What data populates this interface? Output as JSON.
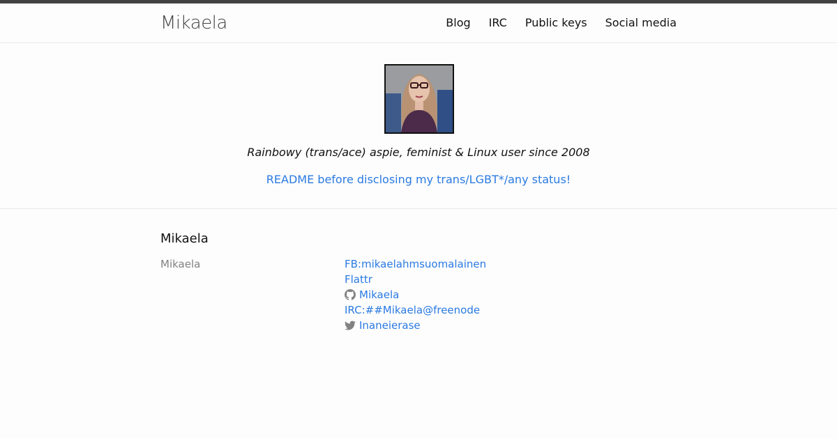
{
  "site": {
    "title": "Mikaela"
  },
  "nav": {
    "items": [
      {
        "label": "Blog"
      },
      {
        "label": "IRC"
      },
      {
        "label": "Public keys"
      },
      {
        "label": "Social media"
      }
    ]
  },
  "hero": {
    "tagline": "Rainbowy (trans/ace) aspie, feminist & Linux user since 2008",
    "readme_link": "README before disclosing my trans/LGBT*/any status!"
  },
  "footer": {
    "heading": "Mikaela",
    "name": "Mikaela",
    "links": [
      {
        "label": "FB:mikaelahmsuomalainen",
        "icon": ""
      },
      {
        "label": "Flattr",
        "icon": ""
      },
      {
        "label": "Mikaela",
        "icon": "github-icon"
      },
      {
        "label": "IRC:##Mikaela@freenode",
        "icon": ""
      },
      {
        "label": "Inaneierase",
        "icon": "twitter-icon"
      }
    ]
  },
  "colors": {
    "link": "#2a7ae2",
    "topbar": "#424242",
    "muted": "#828282"
  }
}
